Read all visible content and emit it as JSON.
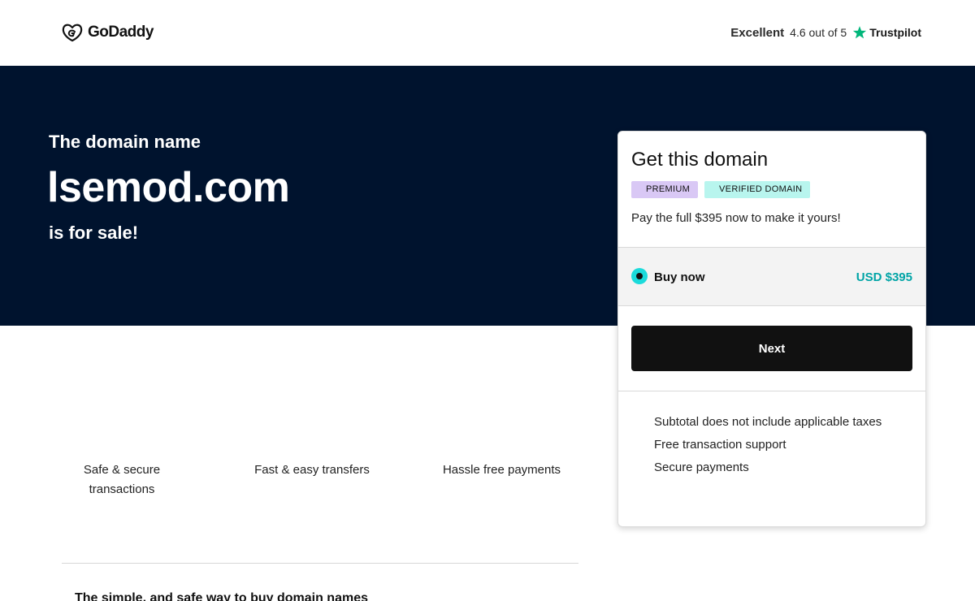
{
  "header": {
    "brand": "GoDaddy",
    "logo_icon": "godaddy-logo-icon",
    "trustpilot": {
      "label": "Excellent",
      "rating_text": "4.6 out of 5",
      "star_icon": "trustpilot-star-icon",
      "brand": "Trustpilot",
      "star_color": "#00b67a"
    }
  },
  "hero": {
    "pre_title": "The domain name",
    "domain": "lsemod.com",
    "post_title": "is for sale!",
    "background": "#00132e"
  },
  "card": {
    "title": "Get this domain",
    "badges": [
      "PREMIUM",
      "VERIFIED DOMAIN"
    ],
    "description": "Pay the full $395 now to make it yours!",
    "option": {
      "label": "Buy now",
      "price": "USD $395",
      "selected": true,
      "price_color": "#00a4a6"
    },
    "next_label": "Next",
    "notes": [
      "Subtotal does not include applicable taxes",
      "Free transaction support",
      "Secure payments"
    ]
  },
  "features": [
    "Safe & secure transactions",
    "Fast & easy transfers",
    "Hassle free payments"
  ],
  "bottom_heading": "The simple, and safe way to buy domain names"
}
